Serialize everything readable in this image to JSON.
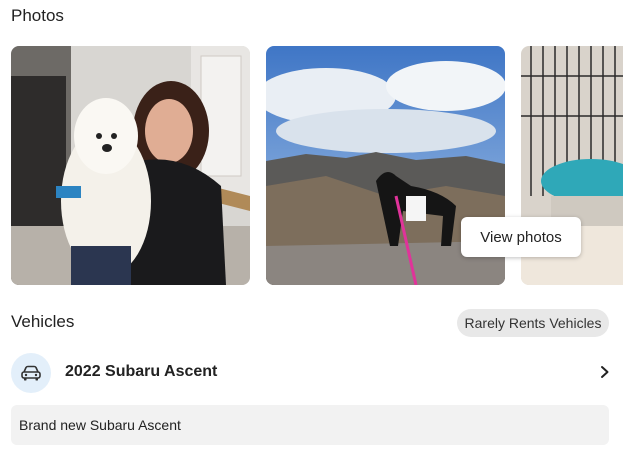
{
  "photos": {
    "title": "Photos",
    "view_photos_label": "View photos",
    "items": [
      {
        "icon": "photo-woman-with-white-dog"
      },
      {
        "icon": "photo-dog-on-cliff-canyon"
      },
      {
        "icon": "photo-dog-crate-partial"
      }
    ]
  },
  "vehicles": {
    "title": "Vehicles",
    "badge": "Rarely Rents Vehicles",
    "items": [
      {
        "name": "2022 Subaru Ascent",
        "icon": "car-icon",
        "description": "Brand new Subaru Ascent"
      }
    ]
  },
  "colors": {
    "accent_circle": "#e3effa",
    "badge_bg": "#e8e8e8",
    "description_bg": "#f2f2f2"
  }
}
